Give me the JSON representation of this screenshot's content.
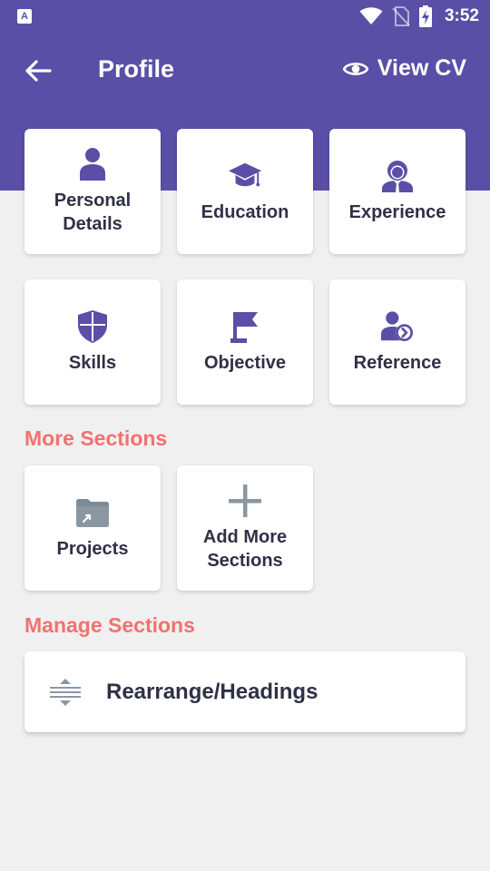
{
  "colors": {
    "header": "#5a4fa6",
    "icon": "#5a4fa6",
    "heading_accent": "#f2726e",
    "muted_icon": "#8a97a3",
    "background": "#f0f0f0"
  },
  "status_bar": {
    "app_icon_letter": "A",
    "time": "3:52",
    "icons": [
      "wifi-icon",
      "no-sim-icon",
      "battery-charging-icon"
    ]
  },
  "appbar": {
    "back_icon": "arrow-left-icon",
    "title": "Profile",
    "action_icon": "eye-icon",
    "action_label": "View CV"
  },
  "main_sections": [
    {
      "label": "Personal\nDetails",
      "icon": "person-icon"
    },
    {
      "label": "Education",
      "icon": "graduation-cap-icon"
    },
    {
      "label": "Experience",
      "icon": "business-person-icon"
    },
    {
      "label": "Skills",
      "icon": "shield-icon"
    },
    {
      "label": "Objective",
      "icon": "flag-icon"
    },
    {
      "label": "Reference",
      "icon": "person-arrow-icon"
    }
  ],
  "more_sections": {
    "heading": "More Sections",
    "items": [
      {
        "label": "Projects",
        "icon": "folder-icon"
      },
      {
        "label": "Add More\nSections",
        "icon": "plus-icon"
      }
    ]
  },
  "manage_sections": {
    "heading": "Manage Sections",
    "item": {
      "label": "Rearrange/Headings",
      "icon": "reorder-icon"
    }
  }
}
